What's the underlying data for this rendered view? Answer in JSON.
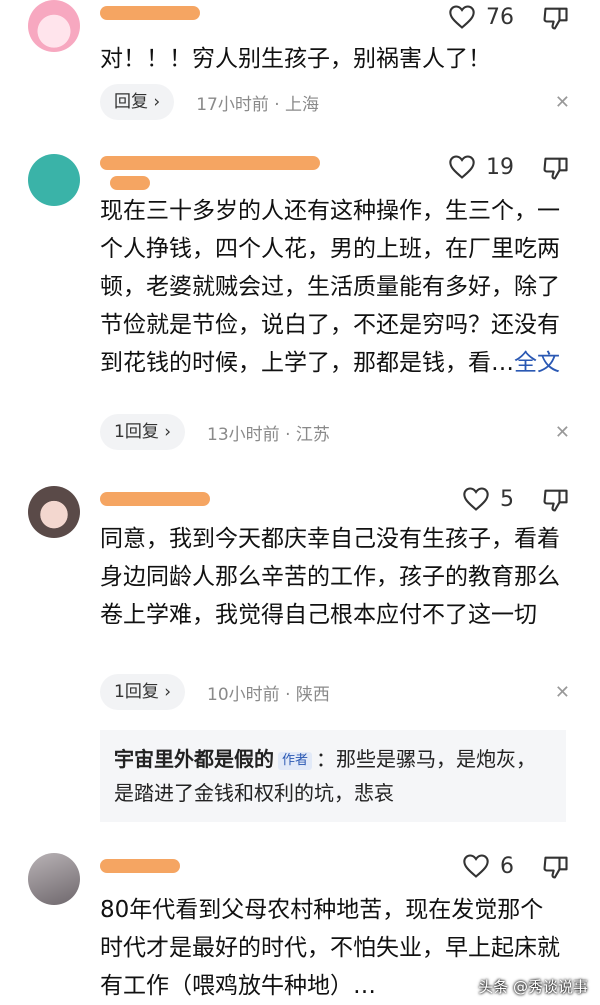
{
  "comments": [
    {
      "likes": "76",
      "text": "对！！！穷人别生孩子，别祸害人了！",
      "reply_label": "回复 ›",
      "meta": "17小时前 · 上海"
    },
    {
      "likes": "19",
      "text": "现在三十多岁的人还有这种操作，生三个，一个人挣钱，四个人花，男的上班，在厂里吃两顿，老婆就贼会过，生活质量能有多好，除了节俭就是节俭，说白了，不还是穷吗？还没有到花钱的时候，上学了，那都是钱，看…",
      "more_label": "全文",
      "reply_label": "1回复 ›",
      "meta": "13小时前 · 江苏"
    },
    {
      "likes": "5",
      "text": "同意，我到今天都庆幸自己没有生孩子，看着身边同龄人那么辛苦的工作，孩子的教育那么卷上学难，我觉得自己根本应付不了这一切",
      "reply_label": "1回复 ›",
      "meta": "10小时前 · 陕西",
      "author_reply": {
        "name": "宇宙里外都是假的",
        "tag": "作者",
        "text": "：那些是骡马，是炮灰，是踏进了金钱和权利的坑，悲哀"
      }
    },
    {
      "likes": "6",
      "text": "80年代看到父母农村种地苦，现在发觉那个时代才是最好的时代，不怕失业，早上起床就有工作（喂鸡放牛种地）…"
    }
  ],
  "watermark": "头条 @秀谈说事"
}
